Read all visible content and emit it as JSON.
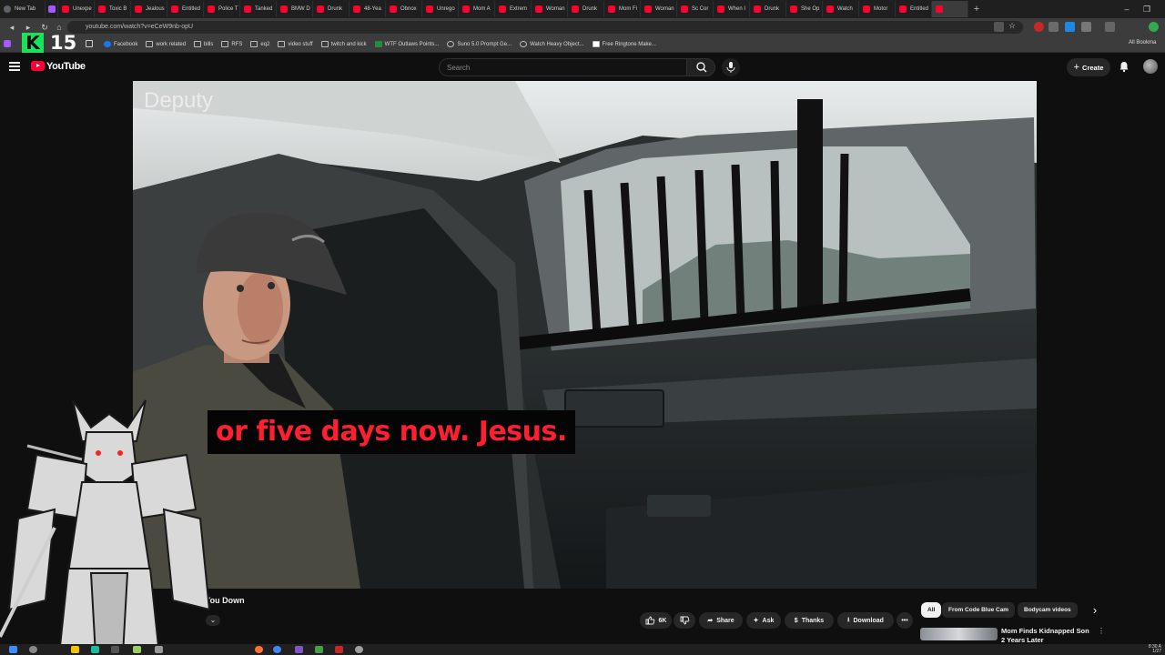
{
  "browser": {
    "tabs": [
      {
        "label": "New Tab",
        "kind": "newtab"
      },
      {
        "label": "",
        "kind": "purple"
      },
      {
        "label": "Unexpe"
      },
      {
        "label": "Toxic B"
      },
      {
        "label": "Jealous"
      },
      {
        "label": "Entitled"
      },
      {
        "label": "Police T"
      },
      {
        "label": "Tanked"
      },
      {
        "label": "BMW D"
      },
      {
        "label": "Drunk"
      },
      {
        "label": "48-Yea"
      },
      {
        "label": "Obnox"
      },
      {
        "label": "Unrego"
      },
      {
        "label": "Mom A"
      },
      {
        "label": "Extrem"
      },
      {
        "label": "Woman"
      },
      {
        "label": "Drunk"
      },
      {
        "label": "Mom Fi"
      },
      {
        "label": "Woman"
      },
      {
        "label": "Sc Cor"
      },
      {
        "label": "When I"
      },
      {
        "label": "Drunk"
      },
      {
        "label": "She Op"
      },
      {
        "label": "Watch"
      },
      {
        "label": "Motor"
      },
      {
        "label": "Entitled"
      },
      {
        "label": "",
        "kind": "active"
      }
    ],
    "new_tab_symbol": "+",
    "window_controls": {
      "minimize": "–",
      "restore": "❐",
      "close": "✕"
    },
    "url": "youtube.com/watch?v=eCeW9nb-opU",
    "bookmarks": [
      {
        "label": "Facebook",
        "icon": "facebook-icon"
      },
      {
        "label": "work related",
        "icon": "folder-icon"
      },
      {
        "label": "bills",
        "icon": "folder-icon"
      },
      {
        "label": "RFS",
        "icon": "folder-icon"
      },
      {
        "label": "eq2",
        "icon": "folder-icon"
      },
      {
        "label": "video stuff",
        "icon": "folder-icon"
      },
      {
        "label": "twitch and kick",
        "icon": "folder-icon"
      },
      {
        "label": "WTF Outlaws Points...",
        "icon": "green-icon"
      },
      {
        "label": "Suno 5.0 Prompt Ge...",
        "icon": "gear-icon"
      },
      {
        "label": "Watch Heavy Object...",
        "icon": "globe-icon"
      },
      {
        "label": "Free Ringtone Make...",
        "icon": "page-icon"
      }
    ],
    "all_bookmarks": "All Bookma"
  },
  "overlay": {
    "kick_logo_letter": "K",
    "kick_count": "15"
  },
  "youtube": {
    "logo_text": "YouTube",
    "search_placeholder": "Search",
    "create_label": "Create",
    "video": {
      "watermark": "Deputy",
      "subtitle": "or five days now. Jesus.",
      "title_fragment": "ts You Down"
    },
    "actions": {
      "likes": "6K",
      "share": "Share",
      "ask": "Ask",
      "thanks": "Thanks",
      "download": "Download",
      "more": "•••"
    },
    "chips": [
      "All",
      "From Code Blue Cam",
      "Bodycam videos"
    ],
    "chips_next": "›",
    "recommendation": {
      "title": "Mom Finds Kidnapped Son 2 Years Later"
    }
  },
  "taskbar": {
    "time": "8:30 A",
    "date": "1/27"
  },
  "colors": {
    "youtube_red": "#ff0033",
    "subtitle_red": "#ff1f33",
    "kick_green": "#19e35a",
    "background": "#0f0f0f"
  }
}
